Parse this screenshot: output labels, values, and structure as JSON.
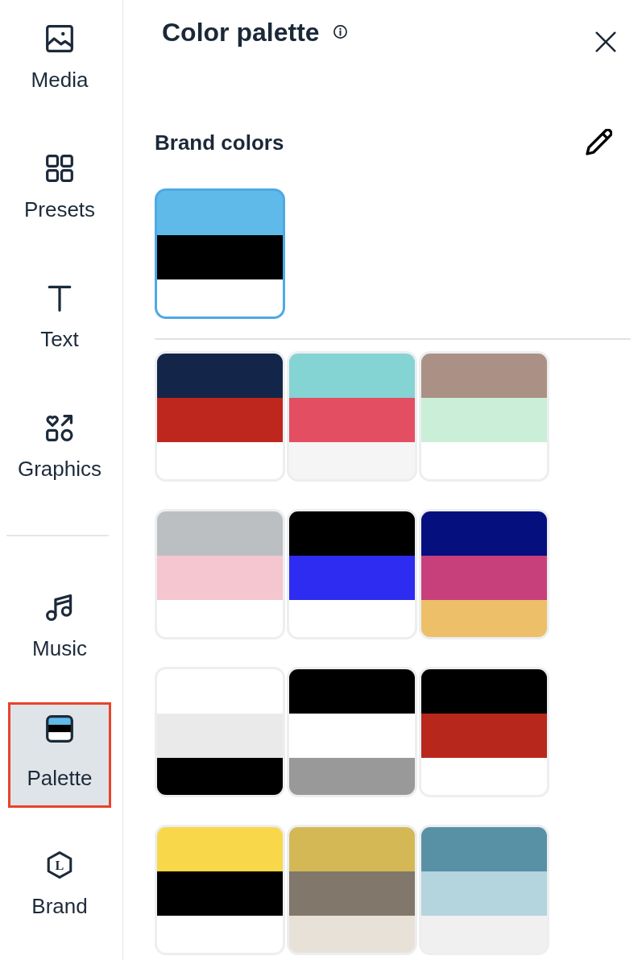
{
  "sidebar": {
    "sections": [
      {
        "items": [
          {
            "label": "Media",
            "selected": false,
            "highlighted": false
          },
          {
            "label": "Presets",
            "selected": false,
            "highlighted": false
          },
          {
            "label": "Text",
            "selected": false,
            "highlighted": false
          },
          {
            "label": "Graphics",
            "selected": false,
            "highlighted": false
          }
        ]
      },
      {
        "items": [
          {
            "label": "Music",
            "selected": false,
            "highlighted": false
          },
          {
            "label": "Palette",
            "selected": true,
            "highlighted": true
          },
          {
            "label": "Brand",
            "selected": false,
            "highlighted": false,
            "icon_text": "L"
          }
        ]
      }
    ]
  },
  "panel": {
    "title": "Color palette",
    "brand_section": {
      "heading": "Brand colors",
      "palettes": [
        {
          "selected": true,
          "stripes": [
            {
              "color": "#5fbae9"
            },
            {
              "color": "#000000"
            },
            {
              "color": "#ffffff"
            }
          ]
        }
      ]
    },
    "palettes": [
      {
        "selected": false,
        "stripes": [
          {
            "color": "#14254a"
          },
          {
            "color": "#be271e"
          },
          {
            "color": "#ffffff"
          }
        ]
      },
      {
        "selected": false,
        "stripes": [
          {
            "color": "#85d4d4"
          },
          {
            "color": "#e34e62"
          },
          {
            "color": "#f5f5f5"
          }
        ]
      },
      {
        "selected": false,
        "stripes": [
          {
            "color": "#ab9185"
          },
          {
            "color": "#cbeed9"
          },
          {
            "color": "#ffffff"
          }
        ]
      },
      {
        "selected": false,
        "stripes": [
          {
            "color": "#bbbfc2"
          },
          {
            "color": "#f5c6d0"
          },
          {
            "color": "#ffffff"
          }
        ]
      },
      {
        "selected": false,
        "stripes": [
          {
            "color": "#000000"
          },
          {
            "color": "#2e2cf0"
          },
          {
            "color": "#ffffff"
          }
        ]
      },
      {
        "selected": false,
        "stripes": [
          {
            "color": "#060f7e"
          },
          {
            "color": "#c8407b"
          },
          {
            "color": "#edbf68"
          }
        ]
      },
      {
        "selected": false,
        "stripes": [
          {
            "color": "#ffffff"
          },
          {
            "color": "#eaeaea"
          },
          {
            "color": "#000000"
          }
        ]
      },
      {
        "selected": false,
        "stripes": [
          {
            "color": "#000000"
          },
          {
            "color": "#ffffff"
          },
          {
            "color": "#999999"
          }
        ]
      },
      {
        "selected": false,
        "stripes": [
          {
            "color": "#000000"
          },
          {
            "color": "#b8271c"
          },
          {
            "color": "#ffffff"
          }
        ]
      },
      {
        "selected": false,
        "stripes": [
          {
            "color": "#f8d74a"
          },
          {
            "color": "#000000"
          },
          {
            "color": "#ffffff"
          }
        ]
      },
      {
        "selected": false,
        "stripes": [
          {
            "color": "#d5b856"
          },
          {
            "color": "#81776a"
          },
          {
            "color": "#e8e1d8"
          }
        ]
      },
      {
        "selected": false,
        "stripes": [
          {
            "color": "#5891a6"
          },
          {
            "color": "#b4d4de"
          },
          {
            "color": "#f0f0f0"
          }
        ]
      }
    ]
  }
}
